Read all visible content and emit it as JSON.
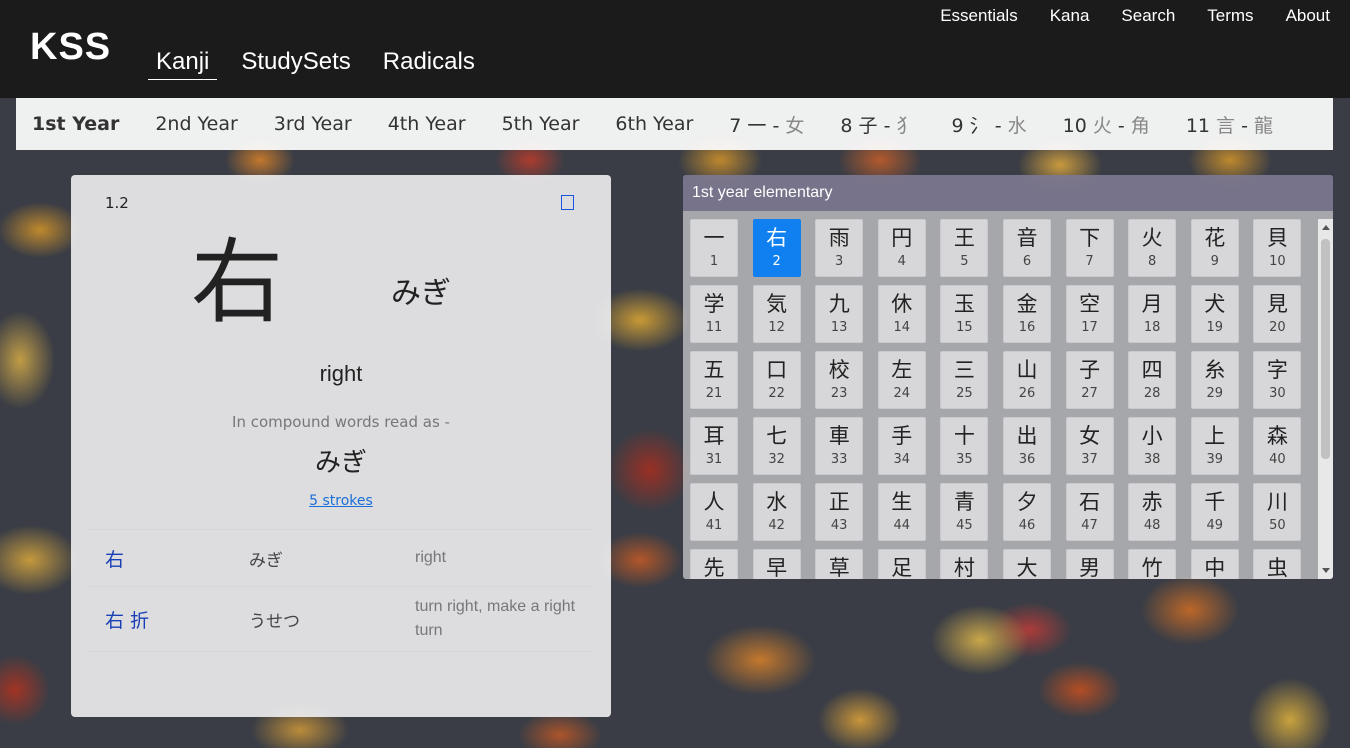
{
  "nav": {
    "logo": "KSS",
    "main": [
      {
        "label": "Kanji",
        "active": true
      },
      {
        "label": "StudySets",
        "active": false
      },
      {
        "label": "Radicals",
        "active": false
      }
    ],
    "utility": [
      "Essentials",
      "Kana",
      "Search",
      "Terms",
      "About"
    ]
  },
  "years": [
    {
      "label": "1st Year",
      "active": true
    },
    {
      "label": "2nd Year"
    },
    {
      "label": "3rd Year"
    },
    {
      "label": "4th Year"
    },
    {
      "label": "5th Year"
    },
    {
      "label": "6th Year"
    },
    {
      "num": "7",
      "from": "一",
      "to": "女"
    },
    {
      "num": "8",
      "from": "子",
      "to": "⺨"
    },
    {
      "num": "9",
      "from": "氵",
      "to": "水"
    },
    {
      "num": "10",
      "from": "火",
      "to": "角"
    },
    {
      "num": "11",
      "from": "言",
      "to": "龍"
    }
  ],
  "detail": {
    "lesson": "1.2",
    "kanji": "右",
    "kun_reading": "みぎ",
    "meaning": "right",
    "compound_note": "In compound words read as -",
    "compound_reading": "みぎ",
    "strokes": "5 strokes",
    "words": [
      {
        "word": "右",
        "reading": "みぎ",
        "meaning": "right"
      },
      {
        "word": "右 折",
        "reading": "うせつ",
        "meaning": "turn right, make a right turn"
      }
    ]
  },
  "grid": {
    "title": "1st year elementary",
    "selected": "2",
    "tiles": [
      {
        "k": "一",
        "n": "1"
      },
      {
        "k": "右",
        "n": "2"
      },
      {
        "k": "雨",
        "n": "3"
      },
      {
        "k": "円",
        "n": "4"
      },
      {
        "k": "王",
        "n": "5"
      },
      {
        "k": "音",
        "n": "6"
      },
      {
        "k": "下",
        "n": "7"
      },
      {
        "k": "火",
        "n": "8"
      },
      {
        "k": "花",
        "n": "9"
      },
      {
        "k": "貝",
        "n": "10"
      },
      {
        "k": "学",
        "n": "11"
      },
      {
        "k": "気",
        "n": "12"
      },
      {
        "k": "九",
        "n": "13"
      },
      {
        "k": "休",
        "n": "14"
      },
      {
        "k": "玉",
        "n": "15"
      },
      {
        "k": "金",
        "n": "16"
      },
      {
        "k": "空",
        "n": "17"
      },
      {
        "k": "月",
        "n": "18"
      },
      {
        "k": "犬",
        "n": "19"
      },
      {
        "k": "見",
        "n": "20"
      },
      {
        "k": "五",
        "n": "21"
      },
      {
        "k": "口",
        "n": "22"
      },
      {
        "k": "校",
        "n": "23"
      },
      {
        "k": "左",
        "n": "24"
      },
      {
        "k": "三",
        "n": "25"
      },
      {
        "k": "山",
        "n": "26"
      },
      {
        "k": "子",
        "n": "27"
      },
      {
        "k": "四",
        "n": "28"
      },
      {
        "k": "糸",
        "n": "29"
      },
      {
        "k": "字",
        "n": "30"
      },
      {
        "k": "耳",
        "n": "31"
      },
      {
        "k": "七",
        "n": "32"
      },
      {
        "k": "車",
        "n": "33"
      },
      {
        "k": "手",
        "n": "34"
      },
      {
        "k": "十",
        "n": "35"
      },
      {
        "k": "出",
        "n": "36"
      },
      {
        "k": "女",
        "n": "37"
      },
      {
        "k": "小",
        "n": "38"
      },
      {
        "k": "上",
        "n": "39"
      },
      {
        "k": "森",
        "n": "40"
      },
      {
        "k": "人",
        "n": "41"
      },
      {
        "k": "水",
        "n": "42"
      },
      {
        "k": "正",
        "n": "43"
      },
      {
        "k": "生",
        "n": "44"
      },
      {
        "k": "青",
        "n": "45"
      },
      {
        "k": "夕",
        "n": "46"
      },
      {
        "k": "石",
        "n": "47"
      },
      {
        "k": "赤",
        "n": "48"
      },
      {
        "k": "千",
        "n": "49"
      },
      {
        "k": "川",
        "n": "50"
      },
      {
        "k": "先",
        "n": ""
      },
      {
        "k": "早",
        "n": ""
      },
      {
        "k": "草",
        "n": ""
      },
      {
        "k": "足",
        "n": ""
      },
      {
        "k": "村",
        "n": ""
      },
      {
        "k": "大",
        "n": ""
      },
      {
        "k": "男",
        "n": ""
      },
      {
        "k": "竹",
        "n": ""
      },
      {
        "k": "中",
        "n": ""
      },
      {
        "k": "虫",
        "n": ""
      }
    ]
  },
  "colors": {
    "selected": "#1080f0",
    "nav_bg": "#1b1b1b",
    "link": "#1a6fd6",
    "word": "#1a3fb5"
  }
}
